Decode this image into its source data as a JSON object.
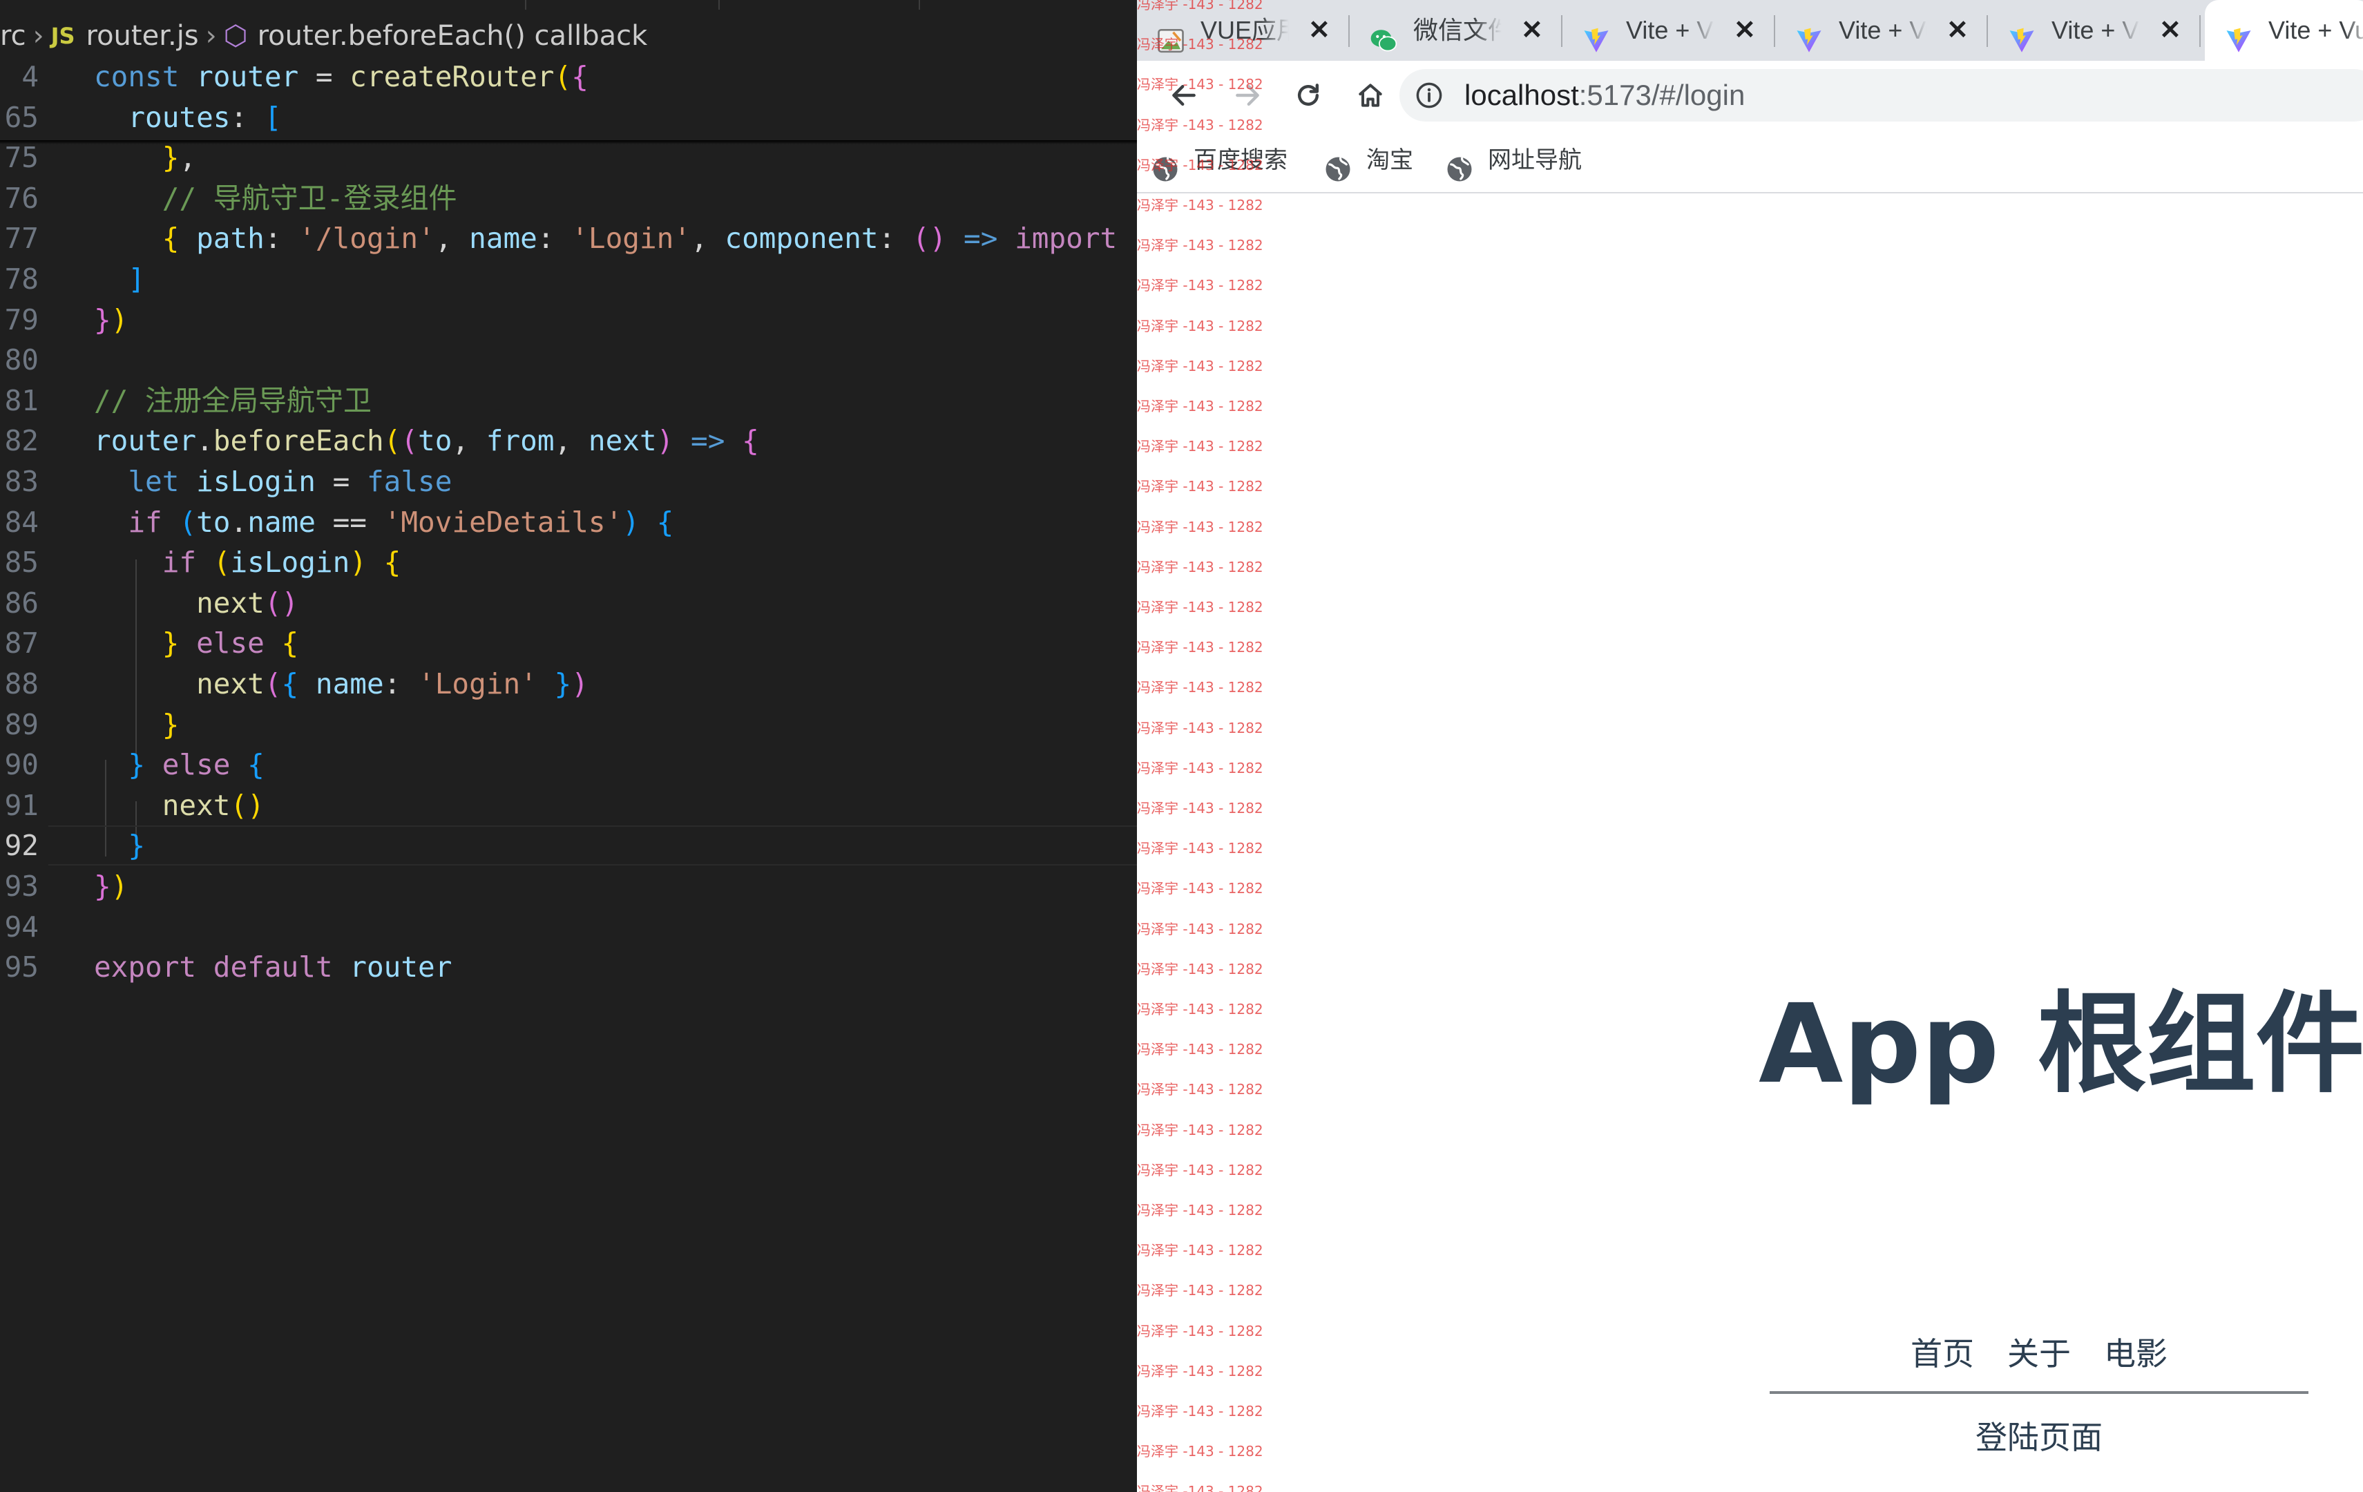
{
  "editor": {
    "breadcrumb": {
      "folder": "rc",
      "file": "router.js",
      "file_badge": "JS",
      "symbol": "router.beforeEach() callback"
    },
    "lines": [
      {
        "num": "4",
        "code": [
          [
            "k",
            "const "
          ],
          [
            "v",
            "router"
          ],
          [
            "",
            " = "
          ],
          [
            "fn",
            "createRouter"
          ],
          [
            "p1",
            "("
          ],
          [
            "p2",
            "{"
          ]
        ]
      },
      {
        "num": "65",
        "code": [
          [
            "",
            "  "
          ],
          [
            "v",
            "routes"
          ],
          [
            "",
            ": "
          ],
          [
            "p3",
            "["
          ]
        ]
      },
      {
        "num": "75",
        "code": [
          [
            "",
            "    "
          ],
          [
            "p1",
            "}"
          ],
          [
            "",
            ","
          ]
        ]
      },
      {
        "num": "76",
        "code": [
          [
            "",
            "    "
          ],
          [
            "c",
            "// 导航守卫-登录组件"
          ]
        ]
      },
      {
        "num": "77",
        "code": [
          [
            "",
            "    "
          ],
          [
            "p1",
            "{ "
          ],
          [
            "v",
            "path"
          ],
          [
            "",
            ": "
          ],
          [
            "s",
            "'/login'"
          ],
          [
            "",
            ", "
          ],
          [
            "v",
            "name"
          ],
          [
            "",
            ": "
          ],
          [
            "s",
            "'Login'"
          ],
          [
            "",
            ", "
          ],
          [
            "v",
            "component"
          ],
          [
            "",
            ": "
          ],
          [
            "p2",
            "()"
          ],
          [
            "",
            " "
          ],
          [
            "k",
            "=>"
          ],
          [
            "",
            " "
          ],
          [
            "kw",
            "import"
          ],
          [
            "",
            " "
          ],
          [
            "p2",
            "("
          ],
          [
            "s",
            "'"
          ]
        ]
      },
      {
        "num": "78",
        "code": [
          [
            "",
            "  "
          ],
          [
            "p3",
            "]"
          ]
        ]
      },
      {
        "num": "79",
        "code": [
          [
            "p2",
            "}"
          ],
          [
            "p1",
            ")"
          ]
        ]
      },
      {
        "num": "80",
        "code": []
      },
      {
        "num": "81",
        "code": [
          [
            "c",
            "// 注册全局导航守卫"
          ]
        ]
      },
      {
        "num": "82",
        "code": [
          [
            "v",
            "router"
          ],
          [
            "",
            "."
          ],
          [
            "fn",
            "beforeEach"
          ],
          [
            "p1",
            "("
          ],
          [
            "p2",
            "("
          ],
          [
            "v",
            "to"
          ],
          [
            "",
            ", "
          ],
          [
            "v",
            "from"
          ],
          [
            "",
            ", "
          ],
          [
            "v",
            "next"
          ],
          [
            "p2",
            ")"
          ],
          [
            "",
            " "
          ],
          [
            "k",
            "=>"
          ],
          [
            "",
            " "
          ],
          [
            "p2",
            "{"
          ]
        ]
      },
      {
        "num": "83",
        "code": [
          [
            "",
            "  "
          ],
          [
            "k",
            "let "
          ],
          [
            "v",
            "isLogin"
          ],
          [
            "",
            " = "
          ],
          [
            "k",
            "false"
          ]
        ]
      },
      {
        "num": "84",
        "code": [
          [
            "",
            "  "
          ],
          [
            "kw",
            "if "
          ],
          [
            "p3",
            "("
          ],
          [
            "v",
            "to"
          ],
          [
            "",
            "."
          ],
          [
            "v",
            "name"
          ],
          [
            "",
            " == "
          ],
          [
            "s",
            "'MovieDetails'"
          ],
          [
            "p3",
            ")"
          ],
          [
            "",
            " "
          ],
          [
            "p3",
            "{"
          ]
        ]
      },
      {
        "num": "85",
        "code": [
          [
            "",
            "    "
          ],
          [
            "kw",
            "if "
          ],
          [
            "p1",
            "("
          ],
          [
            "v",
            "isLogin"
          ],
          [
            "p1",
            ")"
          ],
          [
            "",
            " "
          ],
          [
            "p1",
            "{"
          ]
        ]
      },
      {
        "num": "86",
        "code": [
          [
            "",
            "      "
          ],
          [
            "fn",
            "next"
          ],
          [
            "p2",
            "()"
          ]
        ]
      },
      {
        "num": "87",
        "code": [
          [
            "",
            "    "
          ],
          [
            "p1",
            "}"
          ],
          [
            "",
            " "
          ],
          [
            "kw",
            "else "
          ],
          [
            "p1",
            "{"
          ]
        ]
      },
      {
        "num": "88",
        "code": [
          [
            "",
            "      "
          ],
          [
            "fn",
            "next"
          ],
          [
            "p2",
            "("
          ],
          [
            "p3",
            "{ "
          ],
          [
            "v",
            "name"
          ],
          [
            "",
            ": "
          ],
          [
            "s",
            "'Login'"
          ],
          [
            "p3",
            " }"
          ],
          [
            "p2",
            ")"
          ]
        ]
      },
      {
        "num": "89",
        "code": [
          [
            "",
            "    "
          ],
          [
            "p1",
            "}"
          ]
        ]
      },
      {
        "num": "90",
        "code": [
          [
            "",
            "  "
          ],
          [
            "p3",
            "}"
          ],
          [
            "",
            " "
          ],
          [
            "kw",
            "else "
          ],
          [
            "p3",
            "{"
          ]
        ]
      },
      {
        "num": "91",
        "code": [
          [
            "",
            "    "
          ],
          [
            "fn",
            "next"
          ],
          [
            "p1",
            "()"
          ]
        ]
      },
      {
        "num": "92",
        "code": [
          [
            "",
            "  "
          ],
          [
            "p3",
            "}"
          ]
        ],
        "active": true
      },
      {
        "num": "93",
        "code": [
          [
            "p2",
            "}"
          ],
          [
            "p1",
            ")"
          ]
        ]
      },
      {
        "num": "94",
        "code": []
      },
      {
        "num": "95",
        "code": [
          [
            "kw",
            "export "
          ],
          [
            "kw",
            "default "
          ],
          [
            "v",
            "router"
          ]
        ]
      }
    ]
  },
  "browser": {
    "tabs": [
      {
        "title": "VUE应用",
        "icon": "image-favicon-icon",
        "active": false
      },
      {
        "title": "微信文件",
        "icon": "wechat-icon",
        "active": false
      },
      {
        "title": "Vite + Vue",
        "icon": "vite-logo-icon",
        "active": false
      },
      {
        "title": "Vite + Vue",
        "icon": "vite-logo-icon",
        "active": false
      },
      {
        "title": "Vite + Vue",
        "icon": "vite-logo-icon",
        "active": false
      },
      {
        "title": "Vite + Vue",
        "icon": "vite-logo-icon",
        "active": true
      }
    ],
    "close_glyph": "✕",
    "address": {
      "host": "localhost",
      "path": ":5173/#/login"
    },
    "bookmarks": [
      "百度搜索",
      "淘宝",
      "网址导航"
    ],
    "watermark_text": "冯泽宇 -143 - 1282",
    "page": {
      "title": "App 根组件",
      "nav": [
        "首页",
        "关于",
        "电影"
      ],
      "content": "登陆页面"
    }
  },
  "colors": {
    "editor_bg": "#1f1f1f",
    "keyword_blue": "#569cd6",
    "keyword_purple": "#c586c0",
    "function_yellow": "#dcdcaa",
    "variable": "#9cdcfe",
    "string": "#ce9178",
    "comment": "#6a9955",
    "page_text": "#2c3e50",
    "watermark": "#e12828"
  }
}
